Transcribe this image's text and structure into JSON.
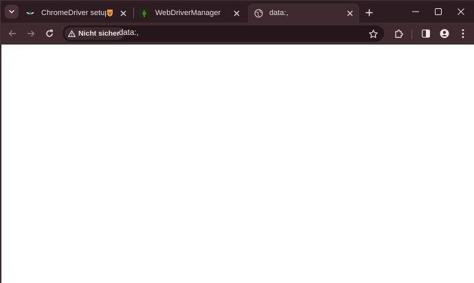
{
  "tabs": [
    {
      "title": "ChromeDriver setup fails - ",
      "favicon": "chrome-driver-favicon",
      "active": false
    },
    {
      "title": "WebDriverManager",
      "favicon": "webdrivermanager-favicon",
      "active": false
    },
    {
      "title": "data:,",
      "favicon": "globe-icon",
      "active": true
    }
  ],
  "toolbar": {
    "security_label": "Nicht sicher",
    "url": "data:,"
  },
  "colors": {
    "frame": "#2d1c21",
    "toolbar": "#3f2a30",
    "omnibox": "#24161a",
    "content": "#ffffff"
  }
}
